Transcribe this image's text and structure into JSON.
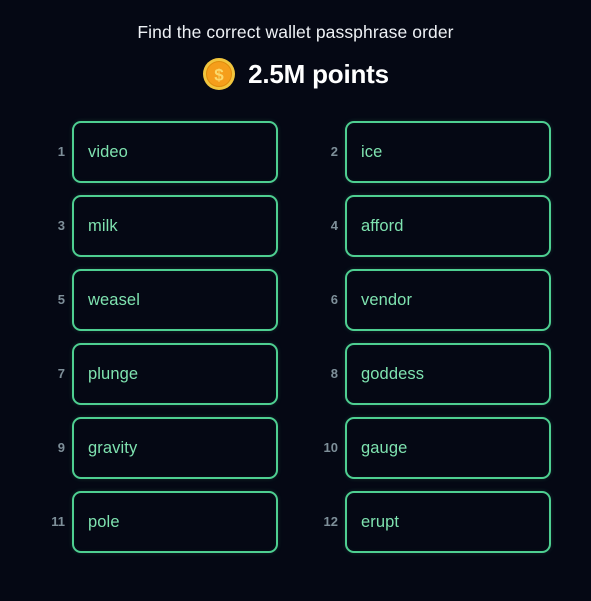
{
  "header": {
    "title": "Find the correct wallet passphrase order",
    "coin_icon": "coin-dollar-icon",
    "points": "2.5M points"
  },
  "colors": {
    "background": "#050814",
    "border_green": "#4ecf91",
    "word_green": "#7fe3b0",
    "index_gray": "#7e8f99",
    "title_white": "#eef1f5",
    "coin_outer": "#f2c53d",
    "coin_inner": "#f59e1b"
  },
  "words": [
    {
      "index": "1",
      "word": "video"
    },
    {
      "index": "2",
      "word": "ice"
    },
    {
      "index": "3",
      "word": "milk"
    },
    {
      "index": "4",
      "word": "afford"
    },
    {
      "index": "5",
      "word": "weasel"
    },
    {
      "index": "6",
      "word": "vendor"
    },
    {
      "index": "7",
      "word": "plunge"
    },
    {
      "index": "8",
      "word": "goddess"
    },
    {
      "index": "9",
      "word": "gravity"
    },
    {
      "index": "10",
      "word": "gauge"
    },
    {
      "index": "11",
      "word": "pole"
    },
    {
      "index": "12",
      "word": "erupt"
    }
  ]
}
